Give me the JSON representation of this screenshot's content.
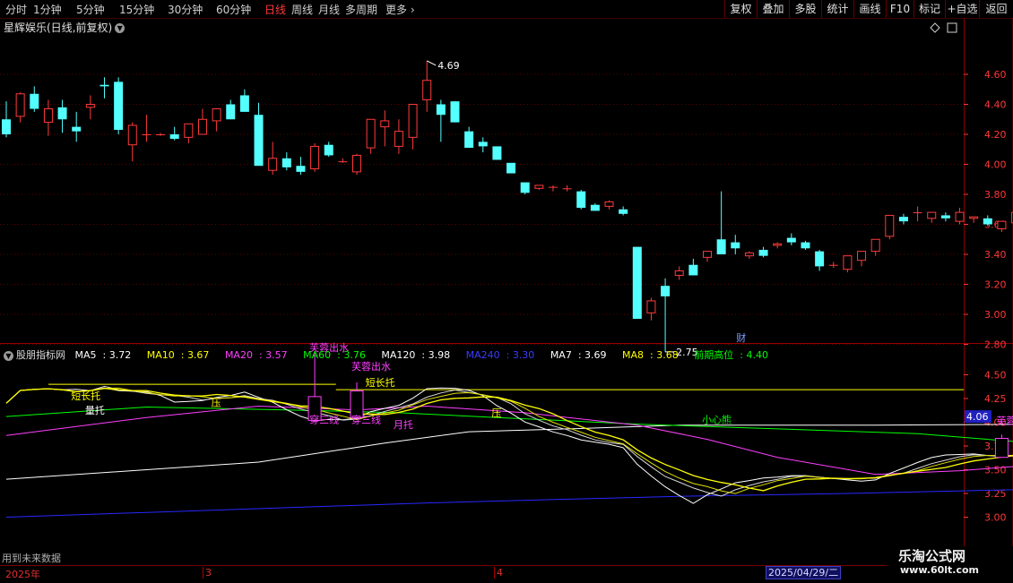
{
  "toolbar": {
    "timeframes": [
      "分时",
      "1分钟",
      "5分钟",
      "15分钟",
      "30分钟",
      "60分钟",
      "日线",
      "周线",
      "月线",
      "多周期",
      "更多"
    ],
    "active_timeframe": "日线",
    "buttons": [
      "复权",
      "叠加",
      "多股",
      "统计",
      "画线",
      "F10",
      "标记",
      "+自选",
      "返回"
    ]
  },
  "stock": {
    "title": "星辉娱乐(日线,前复权)"
  },
  "main_axis": {
    "ticks": [
      "4.60",
      "4.40",
      "4.20",
      "4.00",
      "3.80",
      "3.60",
      "3.40",
      "3.20",
      "3.00",
      "2.80"
    ]
  },
  "main_annotations": {
    "high_label": "4.69",
    "low_label": "2.75",
    "finance_marker": "财"
  },
  "colors": {
    "up": "#ff3b3b",
    "down": "#54ffff",
    "ma5": "#ffffff",
    "ma10": "#ffff00",
    "ma20": "#ff40ff",
    "ma60": "#00ff00",
    "ma120": "#ffffff",
    "ma240": "#2828ff",
    "axis": "#ff3838",
    "grid": "#600000"
  },
  "chart_data": {
    "type": "candlestick",
    "candles": [
      [
        4.3,
        4.42,
        4.18,
        4.2
      ],
      [
        4.32,
        4.48,
        4.28,
        4.47
      ],
      [
        4.47,
        4.52,
        4.35,
        4.37
      ],
      [
        4.28,
        4.43,
        4.19,
        4.37
      ],
      [
        4.38,
        4.43,
        4.21,
        4.3
      ],
      [
        4.25,
        4.35,
        4.15,
        4.22
      ],
      [
        4.38,
        4.46,
        4.3,
        4.4
      ],
      [
        4.53,
        4.58,
        4.44,
        4.52
      ],
      [
        4.55,
        4.58,
        4.2,
        4.23
      ],
      [
        4.13,
        4.28,
        4.02,
        4.26
      ],
      [
        4.2,
        4.33,
        4.15,
        4.2
      ],
      [
        4.2,
        4.21,
        4.19,
        4.2
      ],
      [
        4.2,
        4.25,
        4.16,
        4.17
      ],
      [
        4.18,
        4.25,
        4.14,
        4.27
      ],
      [
        4.2,
        4.37,
        4.22,
        4.3
      ],
      [
        4.29,
        4.34,
        4.22,
        4.37
      ],
      [
        4.4,
        4.43,
        4.3,
        4.3
      ],
      [
        4.46,
        4.5,
        4.35,
        4.35
      ],
      [
        4.33,
        4.41,
        4.25,
        3.99
      ],
      [
        3.96,
        4.15,
        3.93,
        4.04
      ],
      [
        4.04,
        4.08,
        3.96,
        3.98
      ],
      [
        3.99,
        4.05,
        3.93,
        3.95
      ],
      [
        3.97,
        4.14,
        3.95,
        4.12
      ],
      [
        4.13,
        4.15,
        4.05,
        4.06
      ],
      [
        4.02,
        4.04,
        4.01,
        4.02
      ],
      [
        3.95,
        4.07,
        3.93,
        4.06
      ],
      [
        4.11,
        4.25,
        4.07,
        4.3
      ],
      [
        4.25,
        4.36,
        4.12,
        4.29
      ],
      [
        4.12,
        4.3,
        4.07,
        4.22
      ],
      [
        4.18,
        4.4,
        4.1,
        4.4
      ],
      [
        4.43,
        4.69,
        4.35,
        4.56
      ],
      [
        4.4,
        4.43,
        4.15,
        4.33
      ],
      [
        4.42,
        4.42,
        4.28,
        4.28
      ],
      [
        4.22,
        4.25,
        4.11,
        4.11
      ],
      [
        4.15,
        4.18,
        4.08,
        4.12
      ],
      [
        4.12,
        4.1,
        4.03,
        4.03
      ],
      [
        4.01,
        4.0,
        3.94,
        3.94
      ],
      [
        3.88,
        3.86,
        3.8,
        3.81
      ],
      [
        3.84,
        3.86,
        3.83,
        3.86
      ],
      [
        3.85,
        3.86,
        3.82,
        3.85
      ],
      [
        3.84,
        3.86,
        3.82,
        3.84
      ],
      [
        3.82,
        3.83,
        3.7,
        3.71
      ],
      [
        3.73,
        3.74,
        3.69,
        3.69
      ],
      [
        3.72,
        3.76,
        3.7,
        3.75
      ],
      [
        3.7,
        3.72,
        3.66,
        3.67
      ],
      [
        3.45,
        3.45,
        2.97,
        2.97
      ],
      [
        3.01,
        3.11,
        2.96,
        3.09
      ],
      [
        3.19,
        3.24,
        2.75,
        3.12
      ],
      [
        3.26,
        3.32,
        3.23,
        3.29
      ],
      [
        3.33,
        3.37,
        3.26,
        3.26
      ],
      [
        3.38,
        3.42,
        3.35,
        3.42
      ],
      [
        3.5,
        3.82,
        3.4,
        3.4
      ],
      [
        3.48,
        3.53,
        3.4,
        3.44
      ],
      [
        3.39,
        3.42,
        3.37,
        3.41
      ],
      [
        3.43,
        3.45,
        3.38,
        3.39
      ],
      [
        3.46,
        3.48,
        3.44,
        3.47
      ],
      [
        3.51,
        3.54,
        3.46,
        3.48
      ],
      [
        3.48,
        3.49,
        3.43,
        3.44
      ],
      [
        3.42,
        3.43,
        3.29,
        3.32
      ],
      [
        3.33,
        3.35,
        3.31,
        3.33
      ],
      [
        3.3,
        3.35,
        3.28,
        3.39
      ],
      [
        3.36,
        3.38,
        3.32,
        3.42
      ],
      [
        3.42,
        3.48,
        3.39,
        3.5
      ],
      [
        3.52,
        3.64,
        3.5,
        3.66
      ],
      [
        3.65,
        3.67,
        3.6,
        3.62
      ],
      [
        3.68,
        3.72,
        3.62,
        3.68
      ],
      [
        3.64,
        3.67,
        3.61,
        3.68
      ],
      [
        3.66,
        3.68,
        3.62,
        3.64
      ],
      [
        3.62,
        3.71,
        3.6,
        3.68
      ],
      [
        3.64,
        3.65,
        3.61,
        3.65
      ],
      [
        3.64,
        3.66,
        3.59,
        3.6
      ],
      [
        3.57,
        3.62,
        3.55,
        3.62
      ],
      [
        3.61,
        3.64,
        3.58,
        3.68
      ],
      [
        3.65,
        3.83,
        3.64,
        3.84
      ],
      [
        3.76,
        3.8,
        3.73,
        3.77
      ],
      [
        3.72,
        3.79,
        3.66,
        3.75
      ]
    ],
    "indicator": {
      "name": "股朋指标网",
      "legend": [
        {
          "label": "MA5",
          "value": "3.72",
          "color": "#ffffff"
        },
        {
          "label": "MA10",
          "value": "3.67",
          "color": "#ffff00"
        },
        {
          "label": "MA20",
          "value": "3.57",
          "color": "#ff40ff"
        },
        {
          "label": "MA60",
          "value": "3.76",
          "color": "#00ff00"
        },
        {
          "label": "MA120",
          "value": "3.98",
          "color": "#ffffff"
        },
        {
          "label": "MA240",
          "value": "3.30",
          "color": "#2828ff"
        },
        {
          "label": "MA7",
          "value": "3.69",
          "color": "#ffffff"
        },
        {
          "label": "MA8",
          "value": "3.68",
          "color": "#ffff00"
        },
        {
          "label": "前期高位",
          "value": "4.40",
          "color": "#00ff00"
        }
      ],
      "y_ticks": [
        "4.50",
        "4.25",
        "4.00",
        "3.75",
        "3.50",
        "3.25",
        "3.00"
      ],
      "current_value": "4.06",
      "prior_high": 4.4,
      "ma120": [
        [
          0,
          3.4
        ],
        [
          18,
          3.58
        ],
        [
          27,
          3.78
        ],
        [
          33,
          3.9
        ],
        [
          40,
          3.93
        ],
        [
          48,
          3.97
        ],
        [
          62,
          3.97
        ],
        [
          75,
          3.98
        ]
      ],
      "ma240": [
        [
          0,
          3.0
        ],
        [
          10,
          3.05
        ],
        [
          20,
          3.1
        ],
        [
          30,
          3.15
        ],
        [
          40,
          3.19
        ],
        [
          48,
          3.22
        ],
        [
          60,
          3.25
        ],
        [
          75,
          3.3
        ]
      ],
      "ma60": [
        [
          0,
          4.06
        ],
        [
          10,
          4.16
        ],
        [
          20,
          4.13
        ],
        [
          28,
          4.1
        ],
        [
          35,
          4.05
        ],
        [
          45,
          3.98
        ],
        [
          55,
          3.93
        ],
        [
          65,
          3.88
        ],
        [
          75,
          3.76
        ]
      ],
      "ma20": [
        [
          0,
          3.86
        ],
        [
          10,
          4.05
        ],
        [
          18,
          4.17
        ],
        [
          25,
          4.13
        ],
        [
          30,
          4.17
        ],
        [
          37,
          4.1
        ],
        [
          45,
          3.97
        ],
        [
          50,
          3.82
        ],
        [
          55,
          3.63
        ],
        [
          62,
          3.45
        ],
        [
          68,
          3.49
        ],
        [
          75,
          3.57
        ]
      ],
      "annotations": [
        {
          "text": "短长托",
          "color": "#ffff00",
          "idx": 5,
          "y": 4.24
        },
        {
          "text": "量托",
          "color": "#ffffff",
          "idx": 6,
          "y": 4.09
        },
        {
          "text": "压",
          "color": "#ffff00",
          "idx": 15,
          "y": 4.17
        },
        {
          "text": "芙蓉出水",
          "color": "#ff40ff",
          "idx": 22,
          "y": 4.75
        },
        {
          "text": "芙蓉出水",
          "color": "#ff40ff",
          "idx": 25,
          "y": 4.55
        },
        {
          "text": "短长托",
          "color": "#ffff00",
          "idx": 26,
          "y": 4.38
        },
        {
          "text": "穿三线",
          "color": "#ff40ff",
          "idx": 22,
          "y": 3.99
        },
        {
          "text": "穿三线",
          "color": "#ff40ff",
          "idx": 25,
          "y": 3.99
        },
        {
          "text": "月托",
          "color": "#ff40ff",
          "idx": 28,
          "y": 3.94
        },
        {
          "text": "压",
          "color": "#ffff00",
          "idx": 35,
          "y": 4.06
        },
        {
          "text": "小心熊",
          "color": "#00ff00",
          "idx": 50,
          "y": 3.99
        },
        {
          "text": "芙蓉出水",
          "color": "#ff40ff",
          "idx": 71,
          "y": 3.98
        }
      ],
      "boxes": [
        {
          "idx": 22,
          "lo": 4.02,
          "hi": 4.27,
          "wick": 4.73
        },
        {
          "idx": 25,
          "lo": 4.05,
          "hi": 4.33,
          "wick": 4.42
        },
        {
          "idx": 71,
          "lo": 3.63,
          "hi": 3.83,
          "wick": 3.87
        }
      ]
    }
  },
  "bottom": {
    "future_note": "用到未来数据",
    "date_labels": [
      "2025年",
      "3",
      "4"
    ],
    "date_cursor": "2025/04/29/二"
  },
  "watermark": {
    "title": "乐淘公式网",
    "url": "www.60lt.com"
  }
}
